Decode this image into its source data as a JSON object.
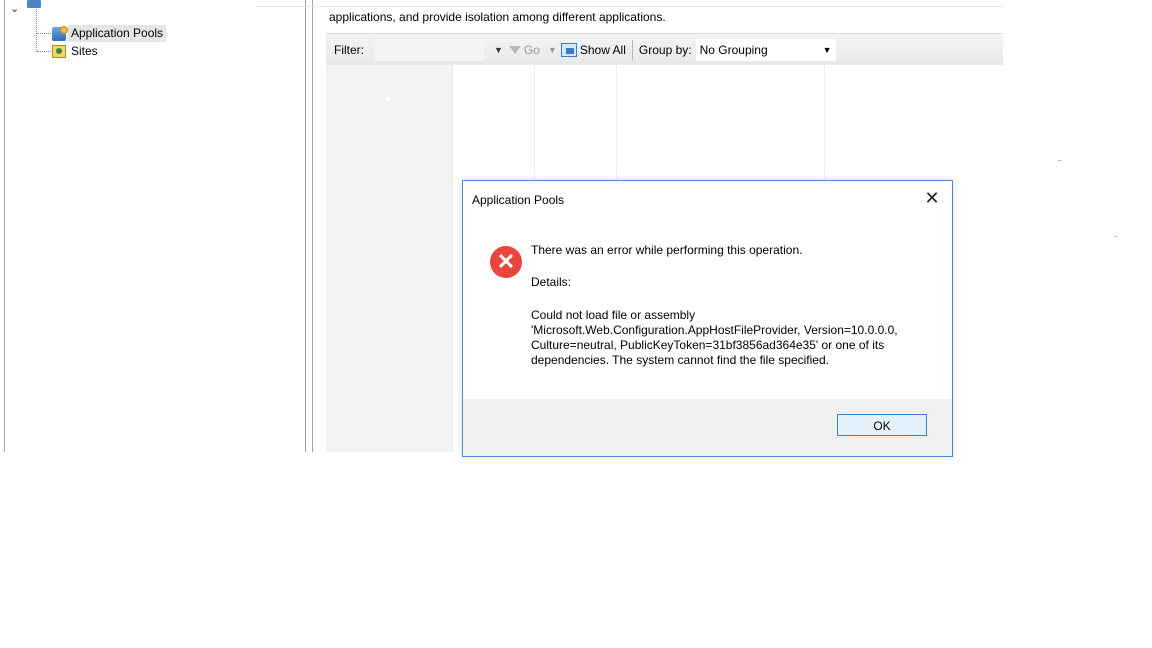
{
  "tree": {
    "items": [
      {
        "label": "Application Pools",
        "icon": "app-pools-icon",
        "selected": true
      },
      {
        "label": "Sites",
        "icon": "sites-icon",
        "selected": false
      }
    ]
  },
  "main": {
    "description_line2": "applications, and provide isolation among different applications."
  },
  "toolbar": {
    "filter_label": "Filter:",
    "go_label": "Go",
    "show_all_label": "Show All",
    "group_by_label": "Group by:",
    "group_by_value": "No Grouping"
  },
  "dialog": {
    "title": "Application Pools",
    "close_glyph": "✕",
    "error_glyph": "✕",
    "message": "There was an error while performing this operation.",
    "details_label": "Details:",
    "details_lines": [
      "Could not load file or assembly",
      "'Microsoft.Web.Configuration.AppHostFileProvider, Version=10.0.0.0,",
      "Culture=neutral, PublicKeyToken=31bf3856ad364e35' or one of its",
      "dependencies. The system cannot find the file specified."
    ],
    "ok_label": "OK"
  },
  "colors": {
    "dialog_border": "#4a8ad4",
    "error_red": "#e8453c",
    "selected_row": "#e5e5e5"
  }
}
